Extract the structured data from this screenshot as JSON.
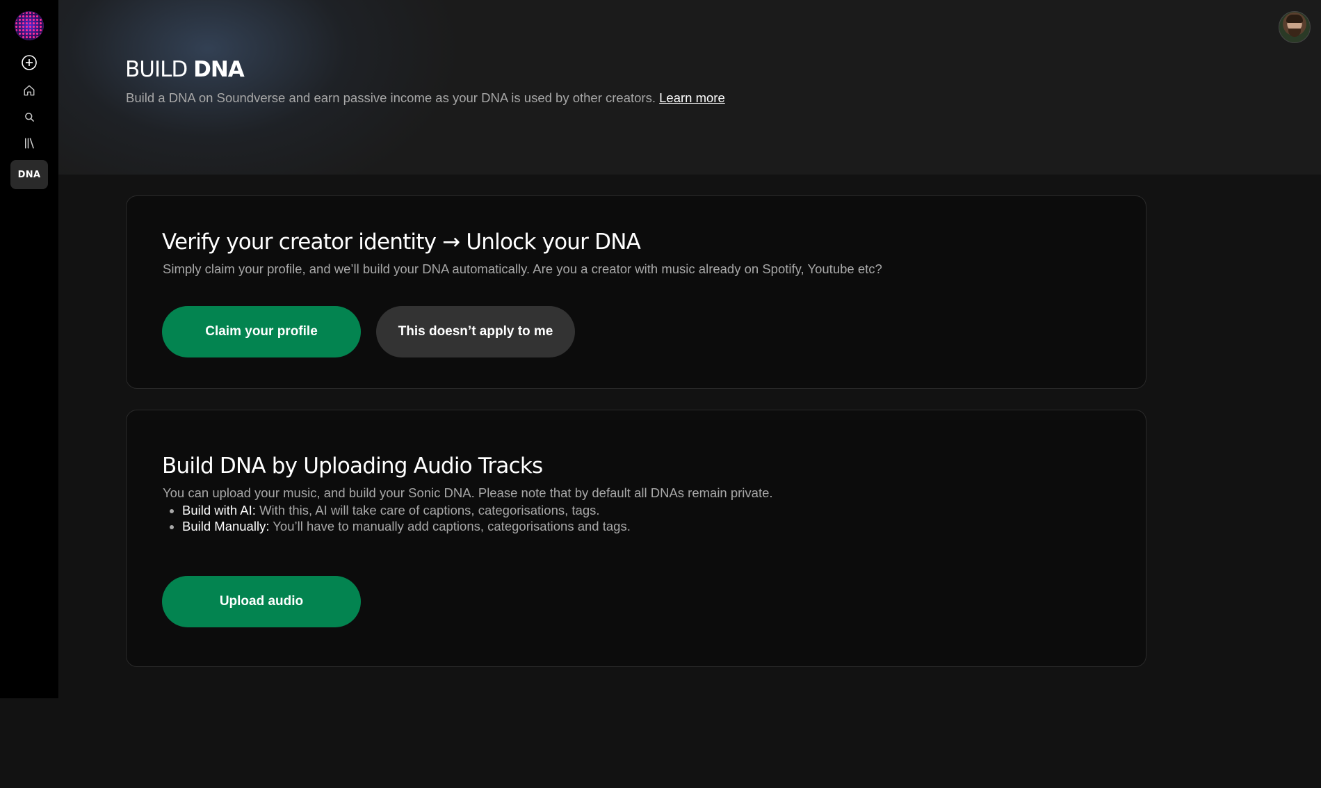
{
  "sidebar": {
    "logo_icon": "soundverse-logo",
    "items": [
      {
        "name": "create",
        "icon": "plus-circle-icon"
      },
      {
        "name": "home",
        "icon": "home-icon"
      },
      {
        "name": "search",
        "icon": "search-icon"
      },
      {
        "name": "library",
        "icon": "library-icon"
      },
      {
        "name": "dna",
        "label": "DNA",
        "active": true
      }
    ]
  },
  "header": {
    "title_light": "BUILD",
    "title_bold": "DNA",
    "description": "Build a DNA on Soundverse and earn passive income as your DNA is used by other creators.",
    "learn_more": "Learn more"
  },
  "user": {
    "avatar_icon": "user-avatar"
  },
  "verify_card": {
    "title": "Verify your creator identity → Unlock your DNA",
    "subtitle": "Simply claim your profile, and we’ll build your DNA automatically. Are you a creator with music already on Spotify, Youtube etc?",
    "primary_button": "Claim your profile",
    "secondary_button": "This doesn’t apply to me"
  },
  "upload_card": {
    "title": "Build DNA by Uploading Audio Tracks",
    "subtitle": "You can upload your music, and build your Sonic DNA. Please note that by default all DNAs remain private.",
    "bullets": [
      {
        "lead": "Build with AI:",
        "text": "With this, AI will take care of captions, categorisations, tags."
      },
      {
        "lead": "Build Manually:",
        "text": "You’ll have to manually add captions, categorisations and tags."
      }
    ],
    "button": "Upload audio"
  },
  "colors": {
    "accent_green": "#038450",
    "secondary_button": "#333333",
    "background": "#121212",
    "sidebar": "#000000"
  }
}
